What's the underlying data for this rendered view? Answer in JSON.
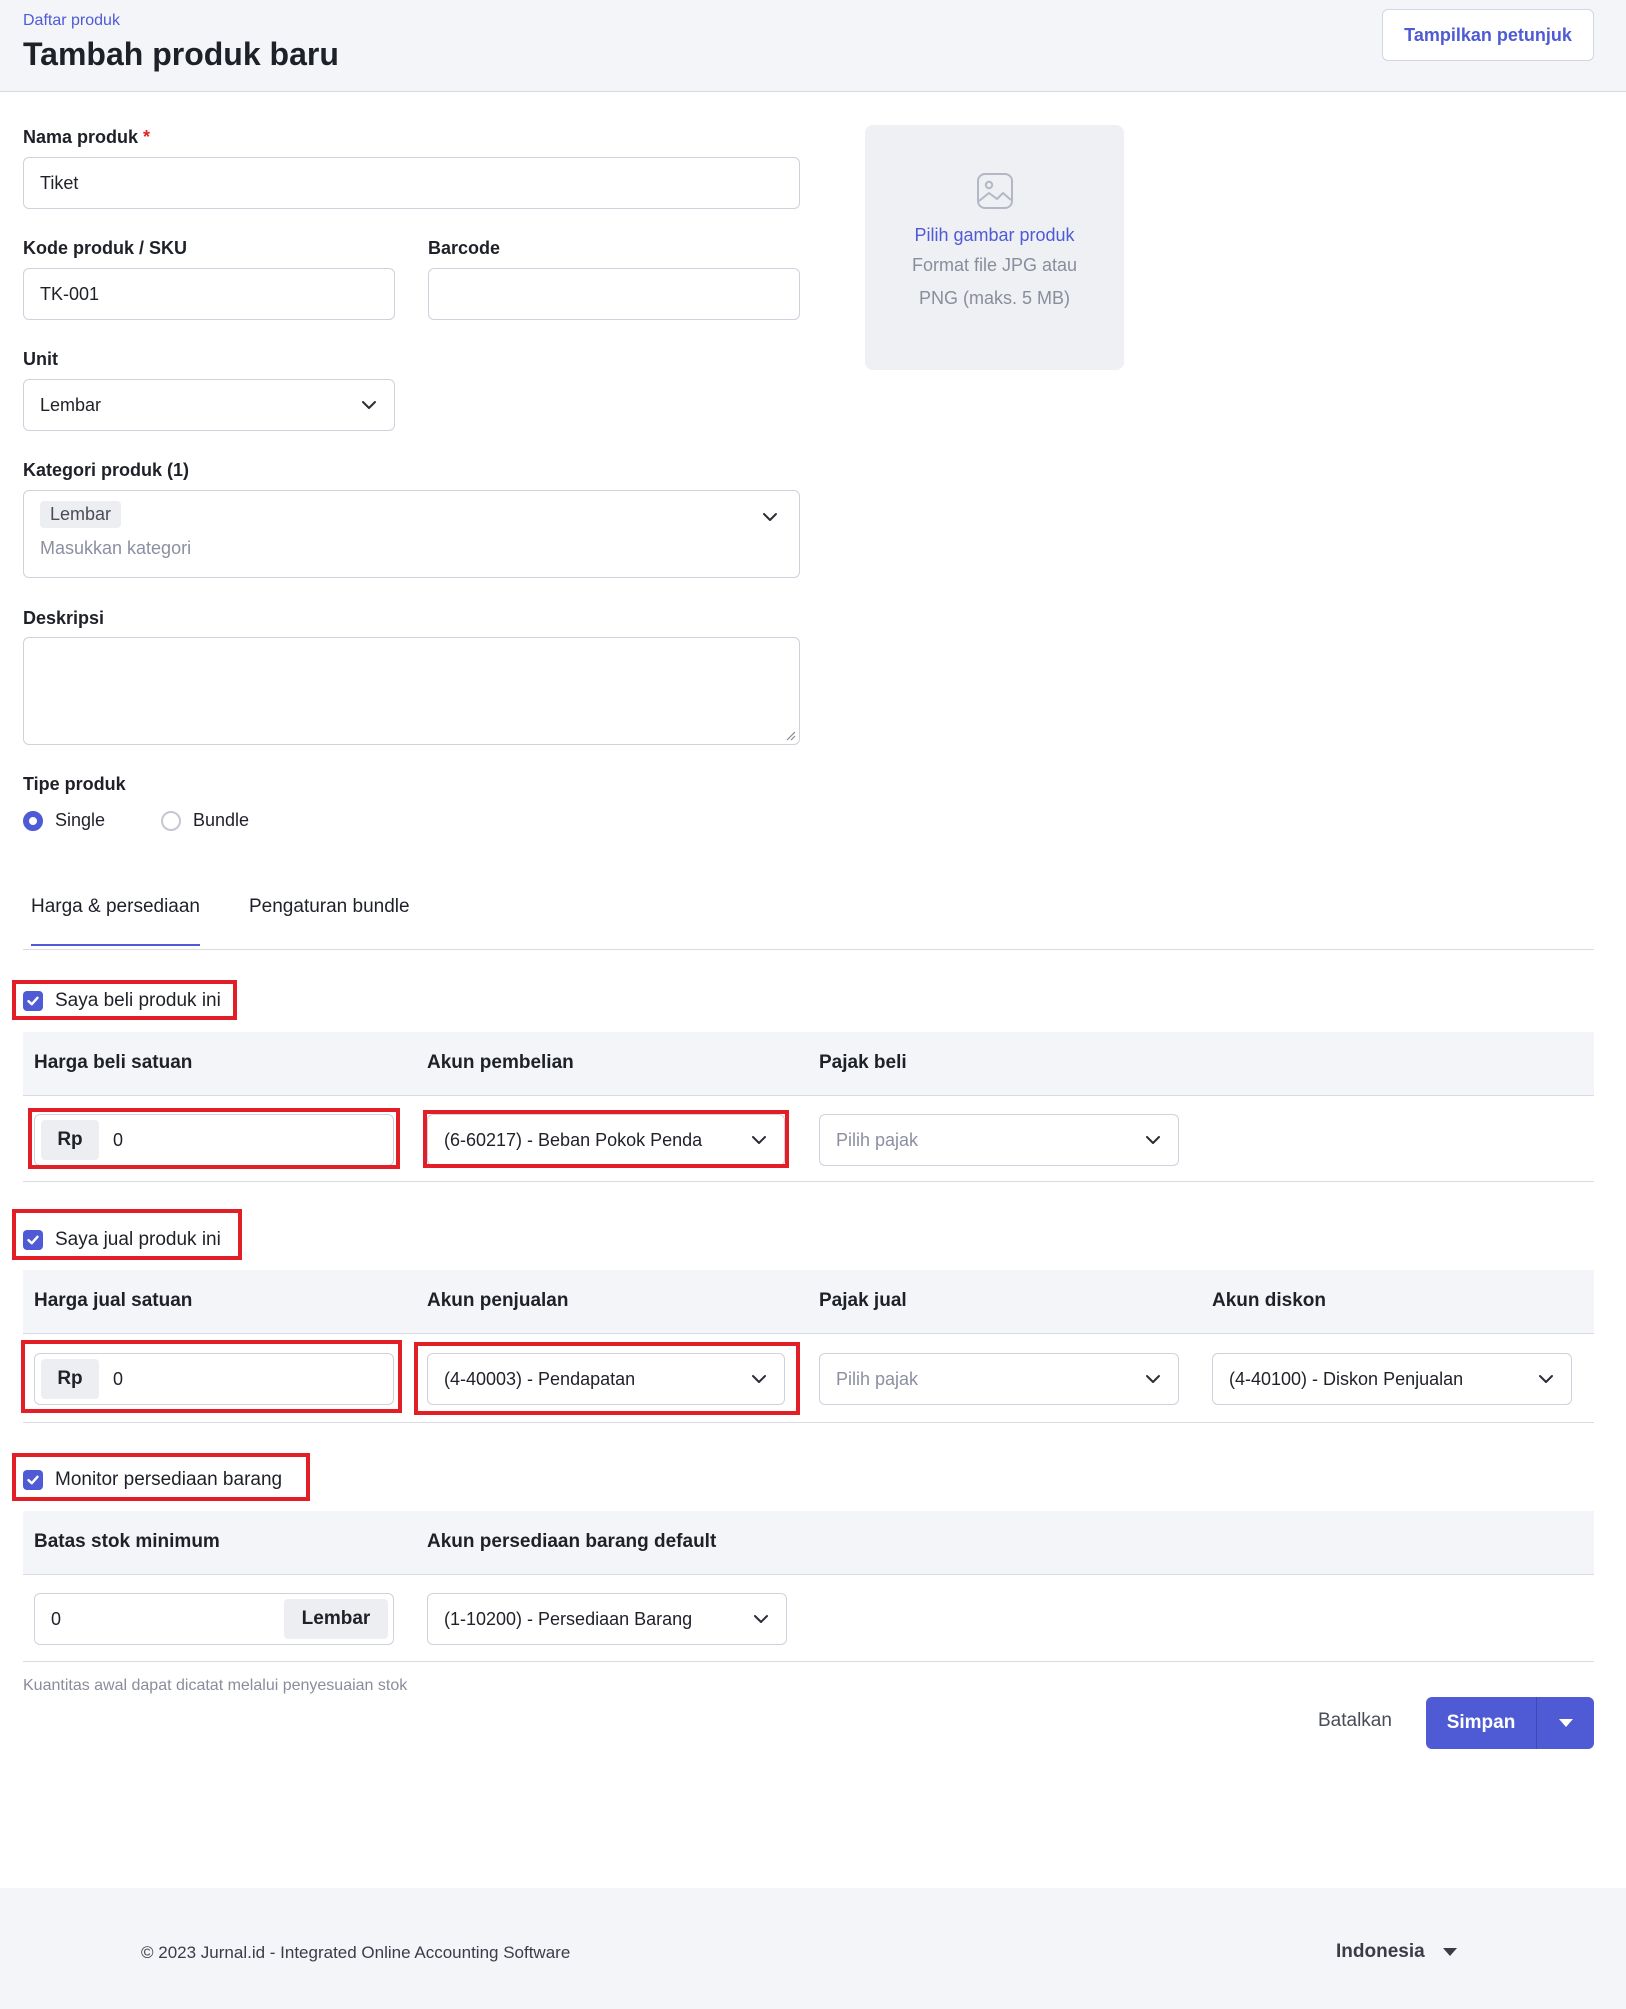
{
  "header": {
    "breadcrumb": "Daftar produk",
    "title": "Tambah produk baru",
    "guide_button": "Tampilkan petunjuk"
  },
  "form": {
    "name_label": "Nama produk",
    "required_mark": "*",
    "name_value": "Tiket",
    "sku_label": "Kode produk / SKU",
    "sku_value": "TK-001",
    "barcode_label": "Barcode",
    "barcode_value": "",
    "unit_label": "Unit",
    "unit_value": "Lembar",
    "category_label": "Kategori produk (1)",
    "category_tag": "Lembar",
    "category_placeholder": "Masukkan kategori",
    "description_label": "Deskripsi",
    "description_value": "",
    "type_label": "Tipe produk",
    "type_options": [
      "Single",
      "Bundle"
    ],
    "type_selected": "Single"
  },
  "image_upload": {
    "pick_label": "Pilih gambar produk",
    "format_hint": "Format file JPG atau PNG (maks. 5 MB)",
    "icon": "image-icon"
  },
  "tabs": [
    {
      "label": "Harga & persediaan",
      "active": true
    },
    {
      "label": "Pengaturan bundle",
      "active": false
    }
  ],
  "buy": {
    "checkbox_label": "Saya beli produk ini",
    "checked": true,
    "col_price": "Harga beli satuan",
    "col_account": "Akun pembelian",
    "col_tax": "Pajak beli",
    "currency": "Rp",
    "price_value": "0",
    "account_value": "(6-60217) - Beban Pokok Penda",
    "tax_placeholder": "Pilih pajak"
  },
  "sell": {
    "checkbox_label": "Saya jual produk ini",
    "checked": true,
    "col_price": "Harga jual satuan",
    "col_account": "Akun penjualan",
    "col_tax": "Pajak jual",
    "col_discount": "Akun diskon",
    "currency": "Rp",
    "price_value": "0",
    "account_value": "(4-40003) - Pendapatan",
    "tax_placeholder": "Pilih pajak",
    "discount_value": "(4-40100) - Diskon Penjualan"
  },
  "inventory": {
    "checkbox_label": "Monitor persediaan barang",
    "checked": true,
    "col_min": "Batas stok minimum",
    "col_account": "Akun persediaan barang default",
    "min_value": "0",
    "unit_suffix": "Lembar",
    "account_value": "(1-10200) - Persediaan Barang"
  },
  "note": "Kuantitas awal dapat dicatat melalui penyesuaian stok",
  "actions": {
    "cancel": "Batalkan",
    "save": "Simpan"
  },
  "footer": {
    "copyright": "© 2023 Jurnal.id - Integrated Online Accounting Software",
    "language": "Indonesia"
  },
  "colors": {
    "accent": "#4f5bd5",
    "highlight": "#e21e26",
    "header_bg": "#f4f5f8"
  }
}
